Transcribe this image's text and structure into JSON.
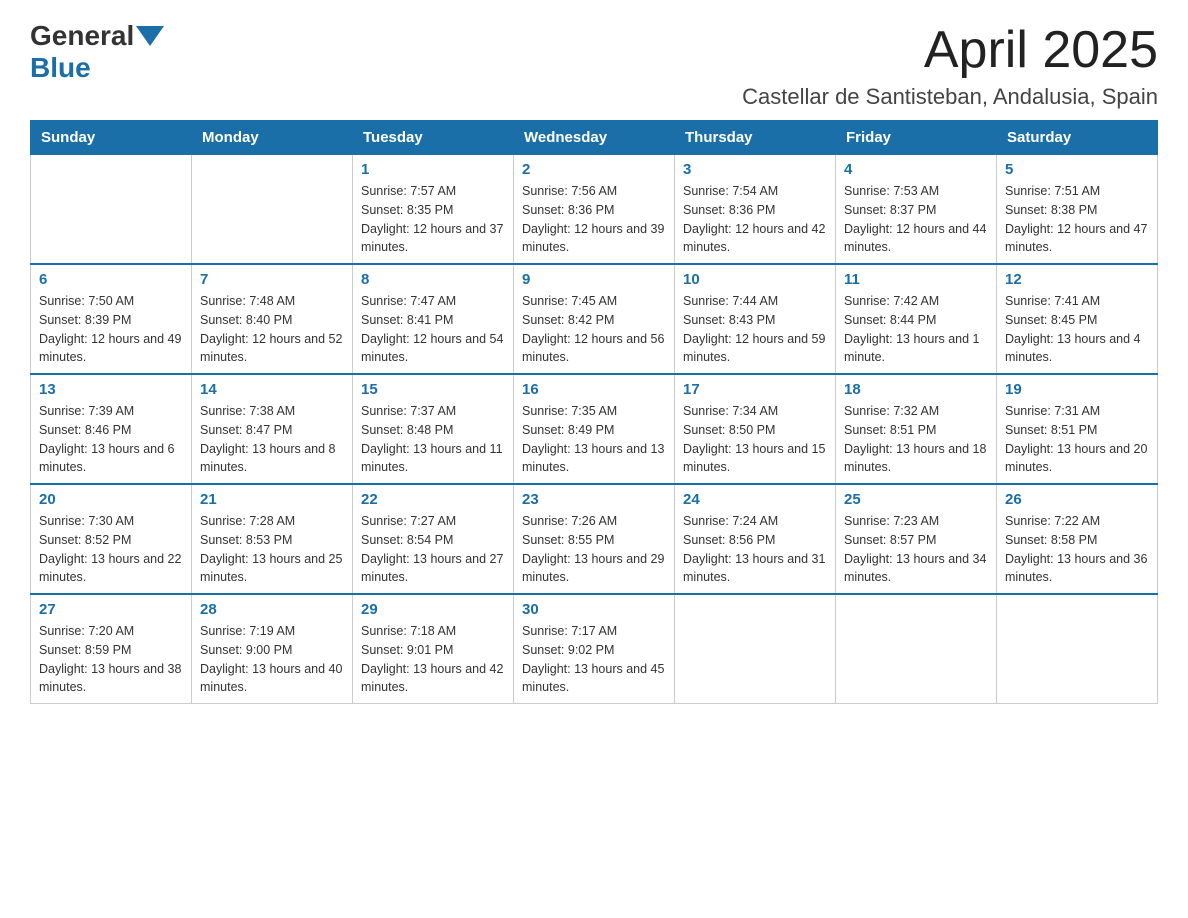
{
  "header": {
    "logo_general": "General",
    "logo_blue": "Blue",
    "month_title": "April 2025",
    "location": "Castellar de Santisteban, Andalusia, Spain"
  },
  "days_of_week": [
    "Sunday",
    "Monday",
    "Tuesday",
    "Wednesday",
    "Thursday",
    "Friday",
    "Saturday"
  ],
  "weeks": [
    [
      {
        "day": "",
        "sunrise": "",
        "sunset": "",
        "daylight": ""
      },
      {
        "day": "",
        "sunrise": "",
        "sunset": "",
        "daylight": ""
      },
      {
        "day": "1",
        "sunrise": "Sunrise: 7:57 AM",
        "sunset": "Sunset: 8:35 PM",
        "daylight": "Daylight: 12 hours and 37 minutes."
      },
      {
        "day": "2",
        "sunrise": "Sunrise: 7:56 AM",
        "sunset": "Sunset: 8:36 PM",
        "daylight": "Daylight: 12 hours and 39 minutes."
      },
      {
        "day": "3",
        "sunrise": "Sunrise: 7:54 AM",
        "sunset": "Sunset: 8:36 PM",
        "daylight": "Daylight: 12 hours and 42 minutes."
      },
      {
        "day": "4",
        "sunrise": "Sunrise: 7:53 AM",
        "sunset": "Sunset: 8:37 PM",
        "daylight": "Daylight: 12 hours and 44 minutes."
      },
      {
        "day": "5",
        "sunrise": "Sunrise: 7:51 AM",
        "sunset": "Sunset: 8:38 PM",
        "daylight": "Daylight: 12 hours and 47 minutes."
      }
    ],
    [
      {
        "day": "6",
        "sunrise": "Sunrise: 7:50 AM",
        "sunset": "Sunset: 8:39 PM",
        "daylight": "Daylight: 12 hours and 49 minutes."
      },
      {
        "day": "7",
        "sunrise": "Sunrise: 7:48 AM",
        "sunset": "Sunset: 8:40 PM",
        "daylight": "Daylight: 12 hours and 52 minutes."
      },
      {
        "day": "8",
        "sunrise": "Sunrise: 7:47 AM",
        "sunset": "Sunset: 8:41 PM",
        "daylight": "Daylight: 12 hours and 54 minutes."
      },
      {
        "day": "9",
        "sunrise": "Sunrise: 7:45 AM",
        "sunset": "Sunset: 8:42 PM",
        "daylight": "Daylight: 12 hours and 56 minutes."
      },
      {
        "day": "10",
        "sunrise": "Sunrise: 7:44 AM",
        "sunset": "Sunset: 8:43 PM",
        "daylight": "Daylight: 12 hours and 59 minutes."
      },
      {
        "day": "11",
        "sunrise": "Sunrise: 7:42 AM",
        "sunset": "Sunset: 8:44 PM",
        "daylight": "Daylight: 13 hours and 1 minute."
      },
      {
        "day": "12",
        "sunrise": "Sunrise: 7:41 AM",
        "sunset": "Sunset: 8:45 PM",
        "daylight": "Daylight: 13 hours and 4 minutes."
      }
    ],
    [
      {
        "day": "13",
        "sunrise": "Sunrise: 7:39 AM",
        "sunset": "Sunset: 8:46 PM",
        "daylight": "Daylight: 13 hours and 6 minutes."
      },
      {
        "day": "14",
        "sunrise": "Sunrise: 7:38 AM",
        "sunset": "Sunset: 8:47 PM",
        "daylight": "Daylight: 13 hours and 8 minutes."
      },
      {
        "day": "15",
        "sunrise": "Sunrise: 7:37 AM",
        "sunset": "Sunset: 8:48 PM",
        "daylight": "Daylight: 13 hours and 11 minutes."
      },
      {
        "day": "16",
        "sunrise": "Sunrise: 7:35 AM",
        "sunset": "Sunset: 8:49 PM",
        "daylight": "Daylight: 13 hours and 13 minutes."
      },
      {
        "day": "17",
        "sunrise": "Sunrise: 7:34 AM",
        "sunset": "Sunset: 8:50 PM",
        "daylight": "Daylight: 13 hours and 15 minutes."
      },
      {
        "day": "18",
        "sunrise": "Sunrise: 7:32 AM",
        "sunset": "Sunset: 8:51 PM",
        "daylight": "Daylight: 13 hours and 18 minutes."
      },
      {
        "day": "19",
        "sunrise": "Sunrise: 7:31 AM",
        "sunset": "Sunset: 8:51 PM",
        "daylight": "Daylight: 13 hours and 20 minutes."
      }
    ],
    [
      {
        "day": "20",
        "sunrise": "Sunrise: 7:30 AM",
        "sunset": "Sunset: 8:52 PM",
        "daylight": "Daylight: 13 hours and 22 minutes."
      },
      {
        "day": "21",
        "sunrise": "Sunrise: 7:28 AM",
        "sunset": "Sunset: 8:53 PM",
        "daylight": "Daylight: 13 hours and 25 minutes."
      },
      {
        "day": "22",
        "sunrise": "Sunrise: 7:27 AM",
        "sunset": "Sunset: 8:54 PM",
        "daylight": "Daylight: 13 hours and 27 minutes."
      },
      {
        "day": "23",
        "sunrise": "Sunrise: 7:26 AM",
        "sunset": "Sunset: 8:55 PM",
        "daylight": "Daylight: 13 hours and 29 minutes."
      },
      {
        "day": "24",
        "sunrise": "Sunrise: 7:24 AM",
        "sunset": "Sunset: 8:56 PM",
        "daylight": "Daylight: 13 hours and 31 minutes."
      },
      {
        "day": "25",
        "sunrise": "Sunrise: 7:23 AM",
        "sunset": "Sunset: 8:57 PM",
        "daylight": "Daylight: 13 hours and 34 minutes."
      },
      {
        "day": "26",
        "sunrise": "Sunrise: 7:22 AM",
        "sunset": "Sunset: 8:58 PM",
        "daylight": "Daylight: 13 hours and 36 minutes."
      }
    ],
    [
      {
        "day": "27",
        "sunrise": "Sunrise: 7:20 AM",
        "sunset": "Sunset: 8:59 PM",
        "daylight": "Daylight: 13 hours and 38 minutes."
      },
      {
        "day": "28",
        "sunrise": "Sunrise: 7:19 AM",
        "sunset": "Sunset: 9:00 PM",
        "daylight": "Daylight: 13 hours and 40 minutes."
      },
      {
        "day": "29",
        "sunrise": "Sunrise: 7:18 AM",
        "sunset": "Sunset: 9:01 PM",
        "daylight": "Daylight: 13 hours and 42 minutes."
      },
      {
        "day": "30",
        "sunrise": "Sunrise: 7:17 AM",
        "sunset": "Sunset: 9:02 PM",
        "daylight": "Daylight: 13 hours and 45 minutes."
      },
      {
        "day": "",
        "sunrise": "",
        "sunset": "",
        "daylight": ""
      },
      {
        "day": "",
        "sunrise": "",
        "sunset": "",
        "daylight": ""
      },
      {
        "day": "",
        "sunrise": "",
        "sunset": "",
        "daylight": ""
      }
    ]
  ]
}
